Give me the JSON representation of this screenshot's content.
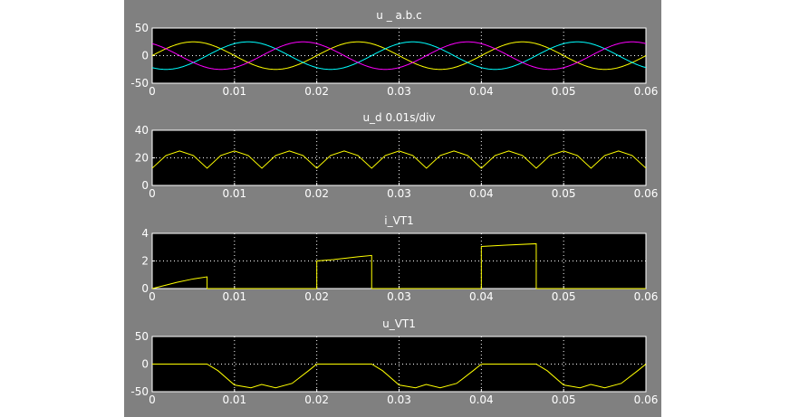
{
  "chart_data": [
    {
      "type": "line",
      "title": "u _ a.b.c",
      "xlim": [
        0,
        0.06
      ],
      "ylim": [
        -50,
        50
      ],
      "x_ticks": [
        "0",
        "0.01",
        "0.02",
        "0.03",
        "0.04",
        "0.05",
        "0.06"
      ],
      "y_ticks": [
        "50",
        "0",
        "-50"
      ],
      "grid": true,
      "series": [
        {
          "color": "#ffff00",
          "x": [
            0,
            0.00333,
            0.00833,
            0.01333,
            0.01833,
            0.02333,
            0.02833,
            0.03333,
            0.03833,
            0.04333,
            0.04833,
            0.05333,
            0.05833,
            0.06
          ],
          "y": [
            0,
            25,
            0,
            -25,
            0,
            25,
            0,
            -25,
            0,
            25,
            0,
            -25,
            0,
            12.5
          ],
          "amplitude": 25,
          "period": 0.02,
          "phase_deg": 0
        },
        {
          "color": "#00ffff",
          "x": [
            0,
            0.00333,
            0.00833,
            0.01333,
            0.01833,
            0.02333,
            0.02833,
            0.03333,
            0.03833,
            0.04333,
            0.04833,
            0.05333,
            0.05833,
            0.06
          ],
          "y": [
            -21.7,
            -21.7,
            12.5,
            25,
            0,
            -25,
            12.5,
            25,
            0,
            -25,
            12.5,
            25,
            0,
            -21.7
          ],
          "amplitude": 25,
          "period": 0.02,
          "phase_deg": -120
        },
        {
          "color": "#ff00ff",
          "x": [
            0,
            0.00333,
            0.00833,
            0.01333,
            0.01833,
            0.02333,
            0.02833,
            0.03333,
            0.03833,
            0.04333,
            0.04833,
            0.05333,
            0.05833,
            0.06
          ],
          "y": [
            21.7,
            0,
            -12.5,
            0,
            25,
            0,
            -25,
            0,
            25,
            0,
            -25,
            0,
            25,
            21.7
          ],
          "amplitude": 25,
          "period": 0.02,
          "phase_deg": 120
        }
      ]
    },
    {
      "type": "line",
      "title": "u_d  0.01s/div",
      "xlim": [
        0,
        0.06
      ],
      "ylim": [
        0,
        40
      ],
      "x_ticks": [
        "0",
        "0.01",
        "0.02",
        "0.03",
        "0.04",
        "0.05",
        "0.06"
      ],
      "y_ticks": [
        "40",
        "20",
        "0"
      ],
      "grid": true,
      "series": [
        {
          "color": "#ffff00",
          "x": [
            0,
            0.00167,
            0.00333,
            0.005,
            0.00667,
            0.00833,
            0.01,
            0.01167,
            0.01333,
            0.015,
            0.01667,
            0.01833,
            0.02,
            0.02167,
            0.02333,
            0.025,
            0.02667,
            0.02833,
            0.03,
            0.03167,
            0.03333,
            0.035,
            0.03667,
            0.03833,
            0.04,
            0.04167,
            0.04333,
            0.045,
            0.04667,
            0.04833,
            0.05,
            0.05167,
            0.05333,
            0.055,
            0.05667,
            0.05833,
            0.06
          ],
          "y": [
            12.5,
            21.7,
            25,
            21.7,
            12.5,
            21.7,
            25,
            21.7,
            12.5,
            21.7,
            25,
            21.7,
            12.5,
            21.7,
            25,
            21.7,
            12.5,
            21.7,
            25,
            21.7,
            12.5,
            21.7,
            25,
            21.7,
            12.5,
            21.7,
            25,
            21.7,
            12.5,
            21.7,
            25,
            21.7,
            12.5,
            21.7,
            25,
            21.7,
            12.5
          ]
        }
      ]
    },
    {
      "type": "line",
      "title": "i_VT1",
      "xlim": [
        0,
        0.06
      ],
      "ylim": [
        0,
        4
      ],
      "x_ticks": [
        "0",
        "0.01",
        "0.02",
        "0.03",
        "0.04",
        "0.05",
        "0.06"
      ],
      "y_ticks": [
        "4",
        "2",
        "0"
      ],
      "grid": true,
      "series": [
        {
          "color": "#ffff00",
          "x": [
            0,
            0.001,
            0.003,
            0.005,
            0.00667,
            0.00667,
            0.02,
            0.02,
            0.022,
            0.025,
            0.02667,
            0.02667,
            0.04,
            0.04,
            0.043,
            0.04667,
            0.04667,
            0.06
          ],
          "y": [
            0,
            0.15,
            0.45,
            0.7,
            0.85,
            0,
            0,
            2.0,
            2.1,
            2.3,
            2.4,
            0,
            0,
            3.05,
            3.15,
            3.25,
            0,
            0
          ]
        }
      ]
    },
    {
      "type": "line",
      "title": "u_VT1",
      "xlim": [
        0,
        0.06
      ],
      "ylim": [
        -50,
        50
      ],
      "x_ticks": [
        "0",
        "0.01",
        "0.02",
        "0.03",
        "0.04",
        "0.05",
        "0.06"
      ],
      "y_ticks": [
        "50",
        "0",
        "-50"
      ],
      "grid": true,
      "series": [
        {
          "color": "#ffff00",
          "x": [
            0,
            0.00667,
            0.008,
            0.01,
            0.012,
            0.0133,
            0.015,
            0.017,
            0.019,
            0.02,
            0.02667,
            0.028,
            0.03,
            0.032,
            0.0333,
            0.035,
            0.037,
            0.039,
            0.04,
            0.04667,
            0.048,
            0.05,
            0.052,
            0.0533,
            0.055,
            0.057,
            0.059,
            0.06
          ],
          "y": [
            0,
            0,
            -12,
            -38,
            -43,
            -37,
            -43,
            -35,
            -12,
            0,
            0,
            -12,
            -38,
            -43,
            -37,
            -43,
            -35,
            -12,
            0,
            0,
            -12,
            -38,
            -43,
            -37,
            -43,
            -35,
            -12,
            0
          ]
        }
      ]
    }
  ]
}
